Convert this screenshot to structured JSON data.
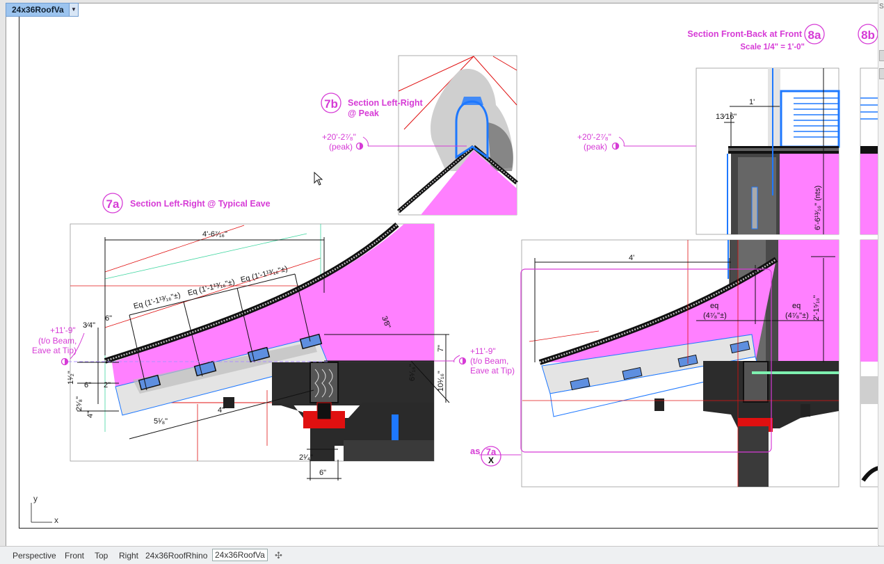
{
  "viewport": {
    "title": "24x36RoofVa",
    "dropdown_icon": "chevron-down-icon"
  },
  "sections": {
    "s7a": {
      "tag": "7a",
      "title": "Section Left-Right @ Typical Eave"
    },
    "s7b": {
      "tag": "7b",
      "title_line1": "Section Left-Right",
      "title_line2": "@  Peak"
    },
    "s8a": {
      "tag": "8a",
      "title": "Section Front-Back at Front",
      "scale": "Scale 1/4\" = 1'-0\""
    },
    "s8b": {
      "tag": "8b"
    }
  },
  "elevations": {
    "peak_left": {
      "value": "+20'-2⁷⁄₈\"",
      "note": "(peak)"
    },
    "peak_right": {
      "value": "+20'-2⁷⁄₈\"",
      "note": "(peak)"
    },
    "eave_left": {
      "value": "+11'-9\"",
      "line2": "(t/o Beam,",
      "line3": "Eave at Tip)"
    },
    "eave_right": {
      "value": "+11'-9\"",
      "line2": "(t/o Beam,",
      "line3": "Eave at Tip)"
    }
  },
  "dims_7a": {
    "top": "4'-6⁷⁄₁₆\"",
    "eq1": "Eq (1'-1¹³⁄₁₆\"±)",
    "eq2": "Eq (1'-1¹³⁄₁₆\"±)",
    "eq3": "Eq (1'-1¹³⁄₁₆\"±)",
    "d6": "6\"",
    "d34": "3⁄4\"",
    "d38": "3⁄8\"",
    "d7": "7\"",
    "d6_5_16": "6⁵⁄₁₆\"",
    "d10_1_16": "10¹⁄₁₆\"",
    "d5_1_8": "5¹⁄₈\"",
    "d4": "4\"",
    "d4b": "4\"",
    "d2_1_4": "2¹⁄₄\"",
    "d6b": "6\"",
    "d1_1_2": "1¹⁄₂\"",
    "d6c": "6\"",
    "d2": "2\"",
    "d2_5_8": "2⁵⁄₈\""
  },
  "dims_8a": {
    "d1": "1'",
    "d13_16": "13⁄16\"",
    "nts": "6'-6¹³⁄₁₆\" (nts)",
    "d4ft": "4'",
    "eq_a": "eq",
    "eq_a_val": "(4⁷⁄₈\"±)",
    "eq_b": "eq",
    "eq_b_val": "(4⁷⁄₈\"±)",
    "d2_1": "2'-1⁵⁄₁₆\""
  },
  "callout": {
    "as": "as",
    "ref": "7a",
    "x": "X"
  },
  "axes": {
    "y": "y",
    "x": "x"
  },
  "tabs": [
    "Perspective",
    "Front",
    "Top",
    "Right",
    "24x36RoofRhino",
    "24x36RoofVa"
  ],
  "add_tab_icon": "plus-icon",
  "gutter_label": "S",
  "colors": {
    "magenta": "#d63bd6",
    "fill_magenta": "#ff80ff",
    "blue": "#1e78ff",
    "red": "#e01010",
    "tab_active": "#9cc4ef"
  }
}
